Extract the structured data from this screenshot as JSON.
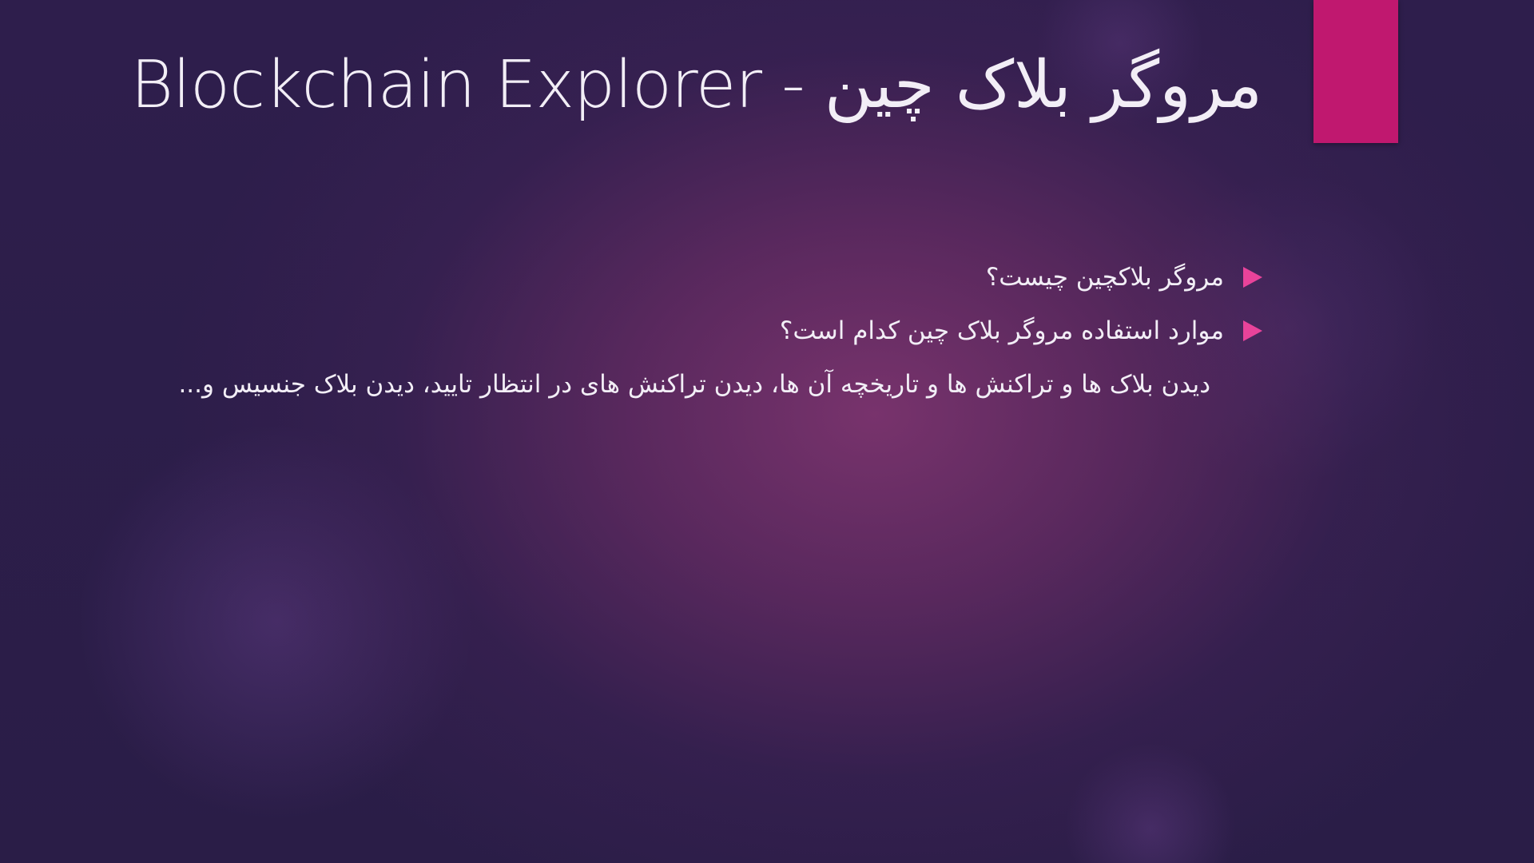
{
  "slide": {
    "title": "Blockchain Explorer - مروگر بلاک چین",
    "bullets": [
      {
        "text": "مروگر بلاکچین چیست؟"
      },
      {
        "text": "موارد استفاده مروگر بلاک چین کدام است؟"
      }
    ],
    "paragraph": "دیدن بلاک ها  و تراکنش ها و تاریخچه آن ها، دیدن تراکنش های در انتظار تایید، دیدن بلاک جنسیس و..."
  },
  "colors": {
    "accent": "#c0186f",
    "bullet_marker": "#e8439a",
    "text": "#f2eef6",
    "background_dark": "#2a1d47",
    "background_glow": "#7c346e"
  }
}
